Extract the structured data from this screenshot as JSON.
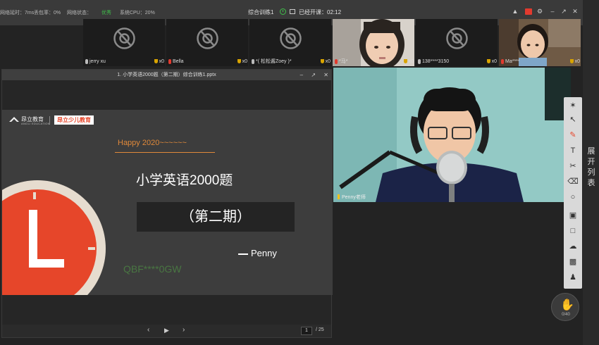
{
  "status_bar": {
    "latency": "网络延时：7ms",
    "packet_loss": "丢包率：0%",
    "network_label": "网络状态：",
    "network_value": "优秀",
    "cpu": "系统CPU：20%",
    "lesson": "综合训练1",
    "class_timer": "已经开课：02:12",
    "accent_good": "#3fbf4a"
  },
  "participants": [
    {
      "name": "jerry xu",
      "count": "x0",
      "camera": "off",
      "mic_muted": false
    },
    {
      "name": "Bella",
      "count": "x0",
      "camera": "off",
      "mic_muted": true
    },
    {
      "name": "*(  松松酱Zoey  )*",
      "count": "x0",
      "camera": "off",
      "mic_muted": false
    },
    {
      "name": "*马*",
      "count": "x0",
      "camera": "on",
      "mic_muted": true
    },
    {
      "name": "138****3150",
      "count": "x0",
      "camera": "off",
      "mic_muted": false
    },
    {
      "name": "Ma****",
      "count": "x0",
      "camera": "on",
      "mic_muted": true
    }
  ],
  "ppt": {
    "title": "1. 小学英语2000题（第二期）综合训练1.pptx",
    "logo_text": "昂立教育",
    "logo_sub": "ANGLI EDUCATION",
    "logo_badge": "昂立少儿教育",
    "happy": "Happy 2020~~~~~~",
    "slide_title": "小学英语2000题",
    "slide_subtitle": "（第二期）",
    "author": "Penny",
    "watermark": "QBF****0GW",
    "page_current": "1",
    "page_total": "/ 25"
  },
  "teacher": {
    "name": "Penny老师"
  },
  "side_panel": {
    "expand_label": "展开列表"
  },
  "hand_raise": {
    "count": "0/40"
  },
  "colors": {
    "brand": "#e6462a",
    "accent_orange": "#e0893a",
    "mic_muted": "#e23a2e",
    "tool_panel": "#d9d9d9"
  }
}
